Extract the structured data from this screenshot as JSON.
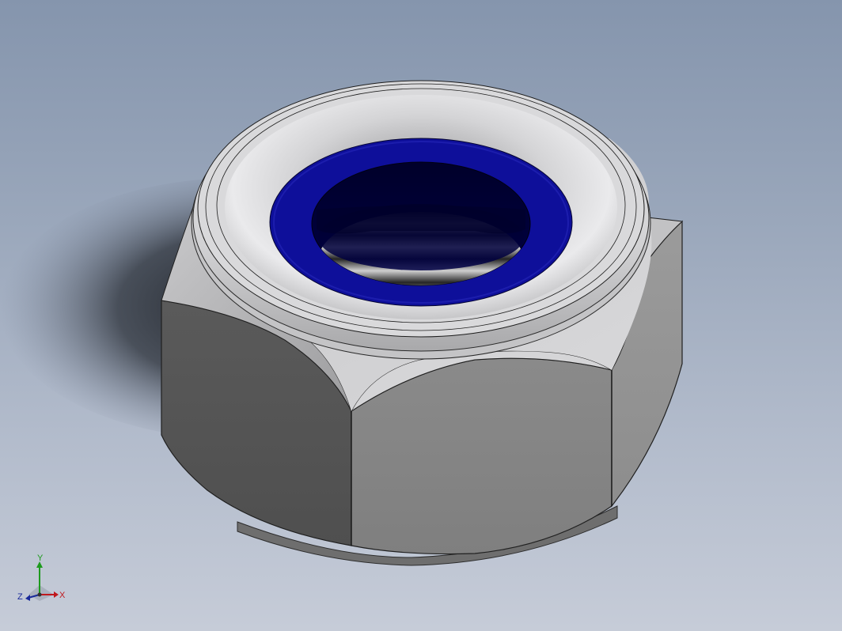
{
  "scene": {
    "model": "nylon-insert-lock-nut",
    "colors": {
      "background_top": "#8595ad",
      "background_bottom": "#c6ccd8",
      "steel_light": "#d7d7d9",
      "steel_mid": "#858585",
      "steel_dark": "#545454",
      "nylon_insert": "#0e0f9a",
      "bore_dark": "#000035",
      "shadow": "#1a1d23"
    }
  },
  "triad": {
    "x_label": "X",
    "y_label": "Y",
    "z_label": "Z",
    "x_color": "#c0181d",
    "y_color": "#1d9a1d",
    "z_color": "#1a2a9a"
  }
}
